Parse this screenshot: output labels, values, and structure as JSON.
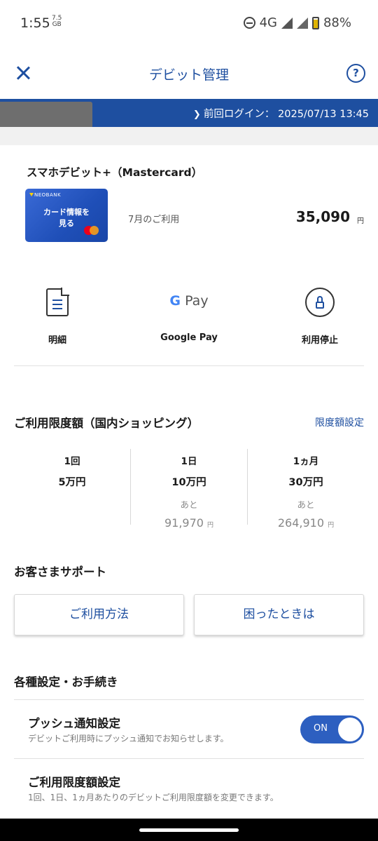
{
  "status_bar": {
    "time": "1:55",
    "data_top": "7.5",
    "data_unit": "GB",
    "network": "4G",
    "battery": "88%"
  },
  "header": {
    "title": "デビット管理",
    "help_label": "?"
  },
  "login": {
    "text": "前回ログイン： 2025/07/13 13:45"
  },
  "card": {
    "name": "スマホデビット+（Mastercard）",
    "brand": "NEOBANK",
    "card_caption_line1": "カード情報を",
    "card_caption_line2": "見る",
    "usage_label": "7月のご利用",
    "usage_amount": "35,090",
    "yen": "円"
  },
  "actions": [
    {
      "label": "明細",
      "icon": "document-icon"
    },
    {
      "label": "Google Pay",
      "icon": "google-pay-icon"
    },
    {
      "label": "利用停止",
      "icon": "lock-icon"
    }
  ],
  "gpay_logo": {
    "g": "G",
    "pay": "Pay"
  },
  "limit": {
    "title": "ご利用限度額（国内ショッピング）",
    "link": "限度額設定",
    "columns": [
      {
        "header": "1回",
        "value": "5万円"
      },
      {
        "header": "1日",
        "value": "10万円",
        "remaining_label": "あと",
        "remaining": "91,970",
        "yen": "円"
      },
      {
        "header": "1ヵ月",
        "value": "30万円",
        "remaining_label": "あと",
        "remaining": "264,910",
        "yen": "円"
      }
    ]
  },
  "support": {
    "title": "お客さまサポート",
    "buttons": [
      "ご利用方法",
      "困ったときは"
    ]
  },
  "settings": {
    "title": "各種設定・お手続き",
    "items": [
      {
        "title": "プッシュ通知設定",
        "desc": "デビットご利用時にプッシュ通知でお知らせします。",
        "toggle": "ON"
      },
      {
        "title": "ご利用限度額設定",
        "desc": "1回、1日、1ヵ月あたりのデビットご利用限度額を変更できます。"
      }
    ]
  },
  "colors": {
    "accent": "#1e4fa0",
    "toggle_on": "#2d5fc0"
  }
}
